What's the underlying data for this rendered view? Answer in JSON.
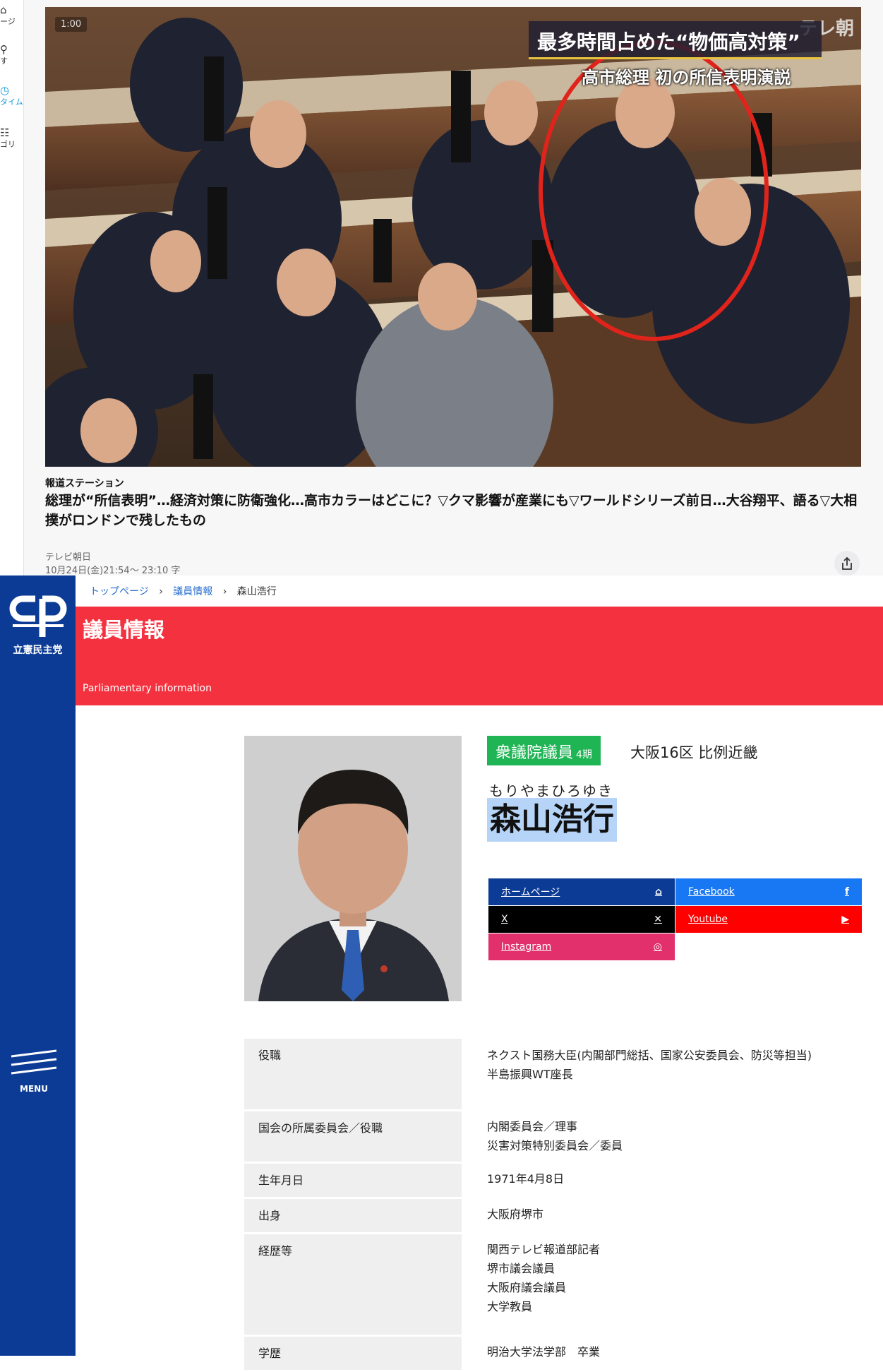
{
  "tv_page": {
    "sidebar": [
      {
        "label": "ージ",
        "icon": "home-icon"
      },
      {
        "label": "す",
        "icon": "search-icon"
      },
      {
        "label": "タイム",
        "icon": "clock-icon"
      },
      {
        "label": "ゴリ",
        "icon": "category-icon"
      }
    ],
    "video": {
      "time": "1:00",
      "channel_mark": "テレ朝",
      "caption_main": "最多時間占めた“物価高対策”",
      "caption_sub": "高市総理 初の所信表明演説",
      "highlight_color": "#e0241c"
    },
    "program": {
      "title": "報道ステーション",
      "headline": "総理が“所信表明”…経済対策に防衛強化…高市カラーはどこに？▽クマ影響が産業にも▽ワールドシリーズ前日…大谷翔平、語る▽大相撲がロンドンで残したもの",
      "broadcaster": "テレビ朝日",
      "airtime": "10月24日(金)21:54〜 23:10 字"
    }
  },
  "cdp_page": {
    "party_name": "立憲民主党",
    "menu_label": "MENU",
    "breadcrumb": [
      "トップページ",
      "議員情報",
      "森山浩行"
    ],
    "hero": {
      "title": "議員情報",
      "subtitle": "Parliamentary information"
    },
    "member": {
      "house": "衆議院議員",
      "term": "4期",
      "district": "大阪16区 比例近畿",
      "kana": "もりやまひろゆき",
      "name": "森山浩行"
    },
    "links": [
      {
        "label": "ホームページ",
        "icon": "home-icon",
        "color": "#0c3b96"
      },
      {
        "label": "Facebook",
        "icon": "facebook-icon",
        "color": "#1877f2"
      },
      {
        "label": "X",
        "icon": "x-icon",
        "color": "#000000"
      },
      {
        "label": "Youtube",
        "icon": "youtube-icon",
        "color": "#ff0000"
      },
      {
        "label": "Instagram",
        "icon": "instagram-icon",
        "color": "#e1306c"
      }
    ],
    "profile": [
      {
        "label": "役職",
        "values": [
          "ネクスト国務大臣(内閣部門総括、国家公安委員会、防災等担当)",
          "半島振興WT座長"
        ]
      },
      {
        "label": "国会の所属委員会／役職",
        "values": [
          "内閣委員会／理事",
          "災害対策特別委員会／委員"
        ]
      },
      {
        "label": "生年月日",
        "values": [
          "1971年4月8日"
        ]
      },
      {
        "label": "出身",
        "values": [
          "大阪府堺市"
        ]
      },
      {
        "label": "経歴等",
        "values": [
          "関西テレビ報道部記者",
          "堺市議会議員",
          "大阪府議会議員",
          "大学教員"
        ]
      },
      {
        "label": "学歴",
        "values": [
          "明治大学法学部　卒業"
        ]
      }
    ]
  }
}
